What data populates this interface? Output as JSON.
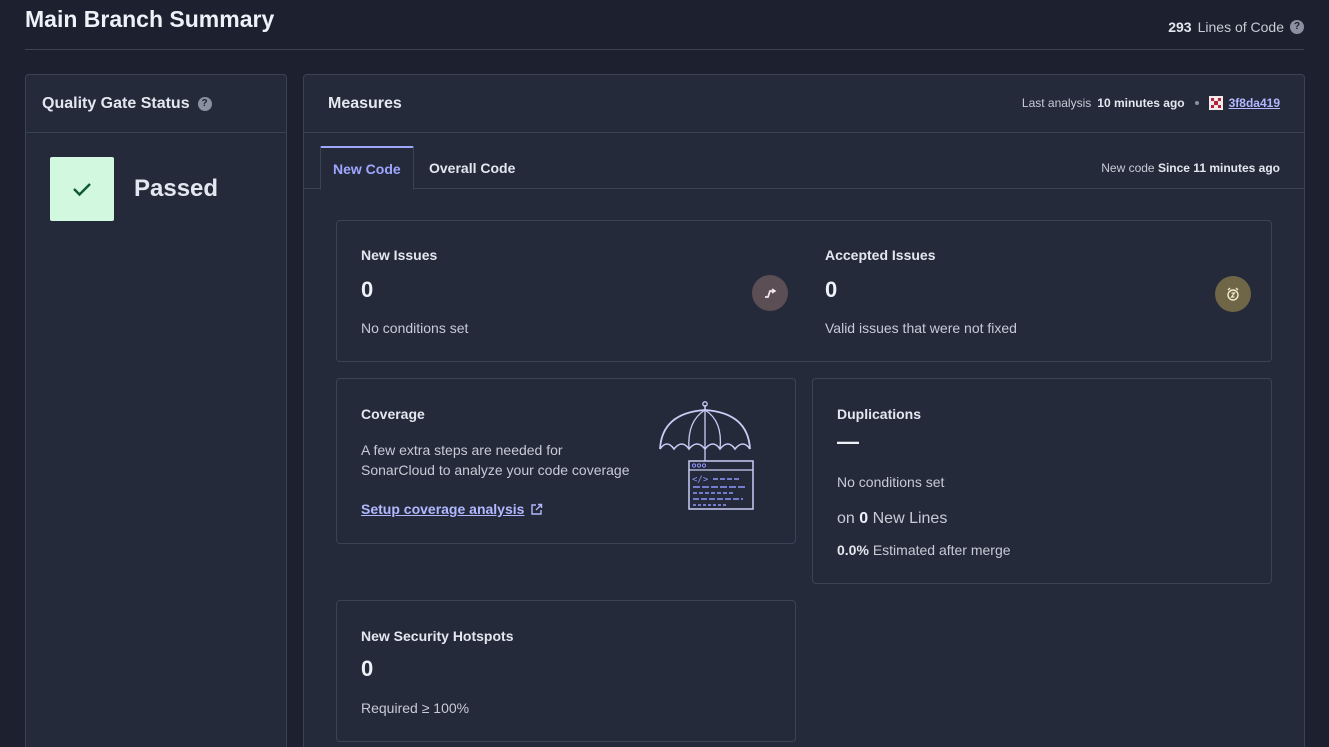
{
  "header": {
    "title": "Main Branch Summary",
    "loc_count": "293",
    "loc_label": "Lines of Code",
    "help": "?"
  },
  "quality_gate": {
    "title": "Quality Gate Status",
    "help": "?",
    "status": "Passed",
    "status_color": "#d2f8e0"
  },
  "measures": {
    "title": "Measures",
    "last_analysis_label": "Last analysis",
    "last_analysis_value": "10 minutes ago",
    "commit": "3f8da419",
    "tabs": [
      {
        "label": "New Code",
        "active": true
      },
      {
        "label": "Overall Code",
        "active": false
      }
    ],
    "new_code_label": "New code",
    "new_code_value": "Since 11 minutes ago"
  },
  "cards": {
    "new_issues": {
      "title": "New Issues",
      "value": "0",
      "sub": "No conditions set"
    },
    "accepted_issues": {
      "title": "Accepted Issues",
      "value": "0",
      "sub": "Valid issues that were not fixed"
    },
    "coverage": {
      "title": "Coverage",
      "text_line1": "A few extra steps are needed for",
      "text_line2": "SonarCloud to analyze your code coverage",
      "link": "Setup coverage analysis"
    },
    "duplications": {
      "title": "Duplications",
      "value": "—",
      "sub": "No conditions set",
      "on_prefix": "on",
      "on_value": "0",
      "on_suffix": "New Lines",
      "estimate_value": "0.0%",
      "estimate_label": "Estimated after merge"
    },
    "hotspots": {
      "title": "New Security Hotspots",
      "value": "0",
      "sub": "Required ≥ 100%"
    }
  },
  "colors": {
    "accent": "#9ea7ff",
    "background": "#1d212f",
    "panel": "#252a3a",
    "passed": "#d2f8e0"
  }
}
